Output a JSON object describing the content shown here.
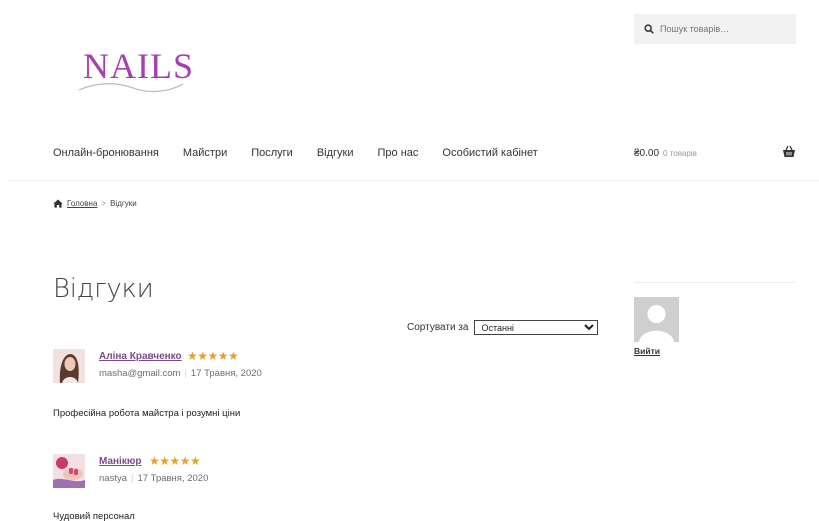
{
  "search": {
    "placeholder": "Пошук товарів…"
  },
  "logo": {
    "text": "NAILS"
  },
  "nav": {
    "items": [
      {
        "label": "Онлайн-бронювання"
      },
      {
        "label": "Майстри"
      },
      {
        "label": "Послуги"
      },
      {
        "label": "Відгуки"
      },
      {
        "label": "Про нас"
      },
      {
        "label": "Особистий кабінет"
      }
    ]
  },
  "cart": {
    "total": "₴0.00",
    "count": "0 товарів"
  },
  "breadcrumb": {
    "home": "Головна",
    "separator": ">",
    "current": "Відгуки"
  },
  "page": {
    "title": "Відгуки"
  },
  "sort": {
    "label": "Сортувати за",
    "selected": "Останні"
  },
  "reviews": [
    {
      "name": "Аліна Кравченко",
      "rating": 5,
      "stars": "★★★★★",
      "email": "masha@gmail.com",
      "date": "17 Травня, 2020",
      "text": "Професійна робота майстра і розумні ціни"
    },
    {
      "name": "Манікюр",
      "rating": 5,
      "stars": "★★★★★",
      "email": "nastya",
      "date": "17 Травня, 2020",
      "text": "Чудовий персонал"
    }
  ],
  "sidebar": {
    "logout": "Вийти"
  },
  "colors": {
    "brand": "#a63fb1",
    "star": "#e6a02e",
    "name_link": "#7b4a8a"
  }
}
